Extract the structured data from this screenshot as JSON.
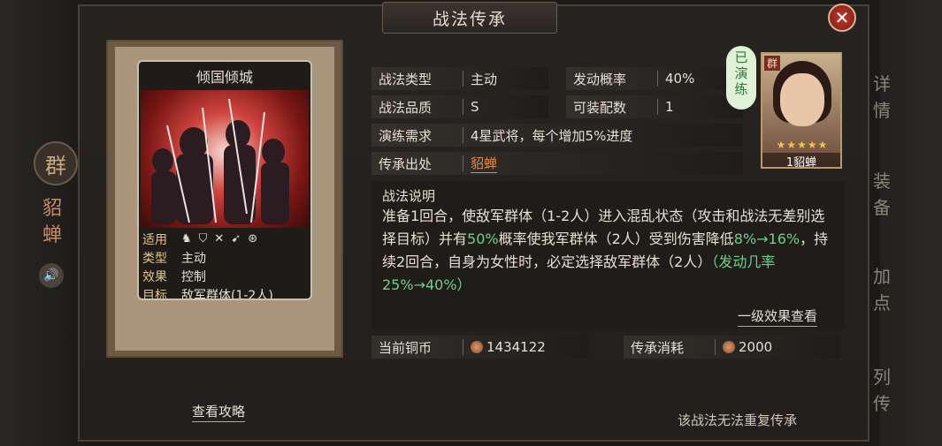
{
  "window": {
    "title": "战法传承",
    "close_label": "✕"
  },
  "left_panel": {
    "faction": "群",
    "name": "貂\n蝉"
  },
  "side_tabs": [
    "详情",
    "装备",
    "加点",
    "列传"
  ],
  "card": {
    "name": "倾国倾城",
    "meta": [
      {
        "key": "适用",
        "value": ""
      },
      {
        "key": "类型",
        "value": "主动"
      },
      {
        "key": "效果",
        "value": "控制"
      },
      {
        "key": "目标",
        "value": "敌军群体(1-2人)"
      }
    ],
    "terrain_icons": [
      "cavalry-icon",
      "shield-icon",
      "bow-icon",
      "spear-icon",
      "wheel-icon"
    ]
  },
  "info": {
    "type_label": "战法类型",
    "type_value": "主动",
    "prob_label": "发动概率",
    "prob_value": "40%",
    "quality_label": "战法品质",
    "quality_value": "S",
    "equip_label": "可装配数",
    "equip_value": "1",
    "req_label": "演练需求",
    "req_value": "4星武将，每个增加5%进度",
    "source_label": "传承出处",
    "source_value": "貂蝉"
  },
  "hero": {
    "faction": "群",
    "stars": "★★★★★",
    "name": "1貂蝉",
    "badge": "已演练"
  },
  "description": {
    "heading": "战法说明",
    "p1": "准备1回合，使敌军群体（1-2人）进入混乱状态（攻击和战法无差别选择目标）并有",
    "p1_g": "50%",
    "p2": "概率使我军群体（2人）受到伤害降低",
    "p2_g": "8%→16%",
    "p3": "，持续2回合，自身为女性时，必定选择敌军群体（2人）",
    "p3_g": "（发动几率25%→40%）"
  },
  "level_effect_link": "一级效果查看",
  "currency": {
    "coins_label": "当前铜币",
    "coins_value": "1434122",
    "cost_label": "传承消耗",
    "cost_value": "2000"
  },
  "view_strategy_link": "查看攻略",
  "footer_note": "该战法无法重复传承",
  "colors": {
    "accent_red": "#c0392b",
    "green_text": "#6fd08a",
    "gold": "#e0c48f"
  }
}
